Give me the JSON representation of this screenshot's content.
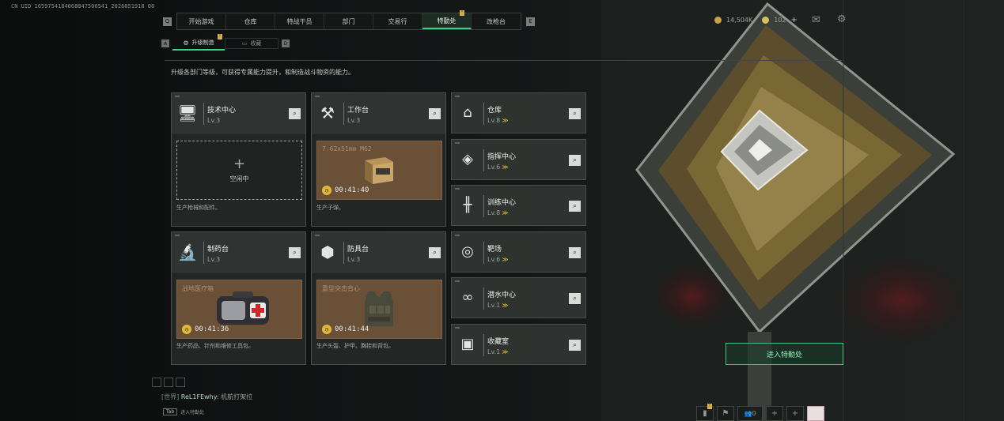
{
  "uid_text": "CN UID 1659754184068847506541_2026051918 08",
  "nav": {
    "left_key": "Q",
    "right_key": "E",
    "tabs": [
      {
        "label": "开始游戏"
      },
      {
        "label": "仓库"
      },
      {
        "label": "特战干员"
      },
      {
        "label": "部门"
      },
      {
        "label": "交易行"
      },
      {
        "label": "特勤处",
        "active": true,
        "flag": "!"
      },
      {
        "label": "改枪台"
      }
    ]
  },
  "subnav": {
    "left_key": "A",
    "right_key": "D",
    "active_label": "升级制造",
    "active_flag": "!",
    "inactive_label": "收藏"
  },
  "description": "升级各部门等级，可获得专属能力提升，和制造战斗物资的能力。",
  "currency": {
    "coins": "14,504K",
    "tokens": "102",
    "plus": "+",
    "coin_color": "#c9a14a",
    "token_color": "#d7c25a"
  },
  "buildings_main": [
    {
      "name": "技术中心",
      "level": "Lv.3",
      "icon": "monitor-icon",
      "slot": "empty",
      "empty_label": "空闲中",
      "empty_plus": "+",
      "footer": "生产枪械和配件。"
    },
    {
      "name": "工作台",
      "level": "Lv.3",
      "icon": "tools-icon",
      "slot": "busy",
      "item": "7.62x51mm M62",
      "timer": "00:41:40",
      "footer": "生产子弹。"
    },
    {
      "name": "制药台",
      "level": "Lv.3",
      "icon": "microscope-icon",
      "slot": "busy",
      "item": "战地医疗箱",
      "timer": "00:41:36",
      "footer": "生产药品、针剂和维修工具包。"
    },
    {
      "name": "防具台",
      "level": "Lv.3",
      "icon": "armor-parts-icon",
      "slot": "busy",
      "item": "重型突击背心",
      "timer": "00:41:44",
      "footer": "生产头盔、护甲、胸挂和背包。"
    }
  ],
  "buildings_side": [
    {
      "name": "仓库",
      "level": "Lv.8",
      "icon": "warehouse-icon",
      "upgradable": true
    },
    {
      "name": "指挥中心",
      "level": "Lv.6",
      "icon": "command-icon",
      "upgradable": true
    },
    {
      "name": "训练中心",
      "level": "Lv.8",
      "icon": "dumbbell-icon",
      "upgradable": true
    },
    {
      "name": "靶场",
      "level": "Lv.6",
      "icon": "target-icon",
      "upgradable": true
    },
    {
      "name": "潜水中心",
      "level": "Lv.1",
      "icon": "diving-mask-icon",
      "upgradable": true
    },
    {
      "name": "收藏室",
      "level": "Lv.1",
      "icon": "portrait-icon",
      "upgradable": true
    }
  ],
  "upgrade_glyph": "≫",
  "search_glyph": "🔍",
  "enter_button": "进入特勤处",
  "chat": {
    "channel": "[世界]",
    "user": "ReL1FEwhy:",
    "message": "机航打架拉"
  },
  "tab_hint": {
    "key": "Tab",
    "label": "进入特勤处"
  },
  "bottom_bar": {
    "mail_flag": "!",
    "friends_count": "0",
    "plus": "+"
  }
}
